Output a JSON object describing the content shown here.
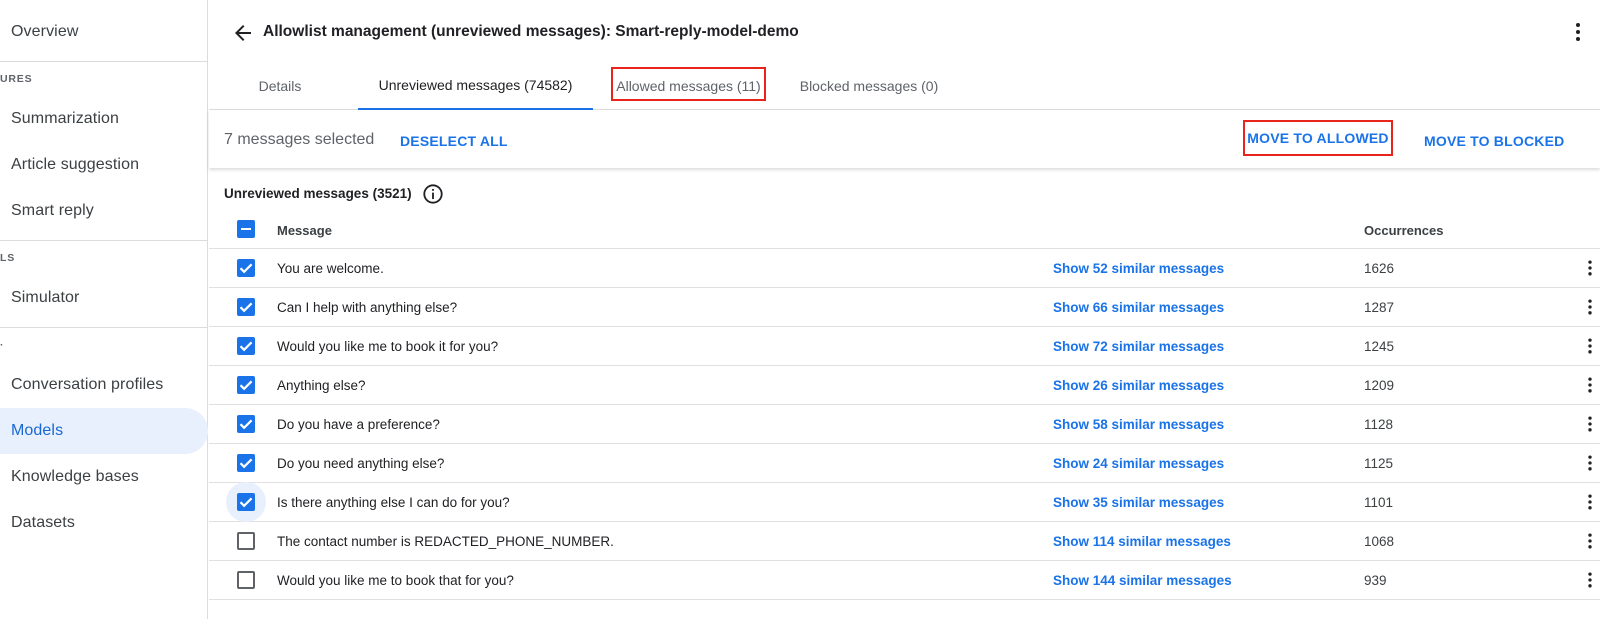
{
  "sidebar": {
    "items": [
      {
        "label": "Overview",
        "active": false
      },
      {
        "label": "Summarization",
        "active": false
      },
      {
        "label": "Article suggestion",
        "active": false
      },
      {
        "label": "Smart reply",
        "active": false
      },
      {
        "label": "Simulator",
        "active": false
      },
      {
        "label": "Conversation profiles",
        "active": false
      },
      {
        "label": "Models",
        "active": true
      },
      {
        "label": "Knowledge bases",
        "active": false
      },
      {
        "label": "Datasets",
        "active": false
      }
    ],
    "sections": [
      "URES",
      "LS",
      "·"
    ]
  },
  "header": {
    "title": "Allowlist management (unreviewed messages): Smart-reply-model-demo"
  },
  "tabs": [
    {
      "label": "Details",
      "active": false
    },
    {
      "label": "Unreviewed messages (74582)",
      "active": true
    },
    {
      "label": "Allowed messages (11)",
      "active": false,
      "highlighted": true
    },
    {
      "label": "Blocked messages (0)",
      "active": false
    }
  ],
  "selection_bar": {
    "count_text": "7 messages selected",
    "deselect_label": "DESELECT ALL",
    "move_allowed_label": "MOVE TO ALLOWED",
    "move_blocked_label": "MOVE TO BLOCKED"
  },
  "section": {
    "title": "Unreviewed messages (3521)"
  },
  "table": {
    "columns": [
      "Message",
      "Occurrences"
    ],
    "header_checkbox_state": "indeterminate",
    "rows": [
      {
        "checked": true,
        "message": "You are welcome.",
        "similar": "Show 52 similar messages",
        "occurrences": "1626"
      },
      {
        "checked": true,
        "message": "Can I help with anything else?",
        "similar": "Show 66 similar messages",
        "occurrences": "1287"
      },
      {
        "checked": true,
        "message": "Would you like me to book it for you?",
        "similar": "Show 72 similar messages",
        "occurrences": "1245"
      },
      {
        "checked": true,
        "message": "Anything else?",
        "similar": "Show 26 similar messages",
        "occurrences": "1209"
      },
      {
        "checked": true,
        "message": "Do you have a preference?",
        "similar": "Show 58 similar messages",
        "occurrences": "1128"
      },
      {
        "checked": true,
        "message": "Do you need anything else?",
        "similar": "Show 24 similar messages",
        "occurrences": "1125"
      },
      {
        "checked": true,
        "focused": true,
        "message": "Is there anything else I can do for you?",
        "similar": "Show 35 similar messages",
        "occurrences": "1101"
      },
      {
        "checked": false,
        "message": "The contact number is REDACTED_PHONE_NUMBER.",
        "similar": "Show 114 similar messages",
        "occurrences": "1068"
      },
      {
        "checked": false,
        "message": "Would you like me to book that for you?",
        "similar": "Show 144 similar messages",
        "occurrences": "939"
      }
    ]
  },
  "colors": {
    "accent": "#1a73e8",
    "highlight_box": "#e8241c",
    "active_nav_bg": "#e8f0fe"
  }
}
